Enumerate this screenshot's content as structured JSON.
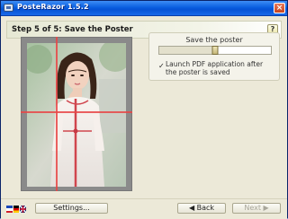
{
  "window": {
    "title": "PosteRazor 1.5.2",
    "close_glyph": "×"
  },
  "header": {
    "step_title": "Step 5 of 5: Save the Poster",
    "help_label": "?"
  },
  "save_panel": {
    "title": "Save the poster",
    "launch_pdf_checked": true,
    "launch_pdf_label": "Launch PDF application after the poster is saved",
    "check_glyph": "✓",
    "slider_value_fraction": 0.5
  },
  "bottom": {
    "settings_label": "Settings...",
    "back_label": "◀ Back",
    "next_label": "Next ▶"
  },
  "colors": {
    "grid_line": "#e84646",
    "titlebar": "#0a5fe0",
    "preview_border": "#8a8a8a"
  },
  "icons": {
    "app": "app-icon",
    "close": "close-icon",
    "help": "help-icon",
    "language": "flags-icon"
  }
}
